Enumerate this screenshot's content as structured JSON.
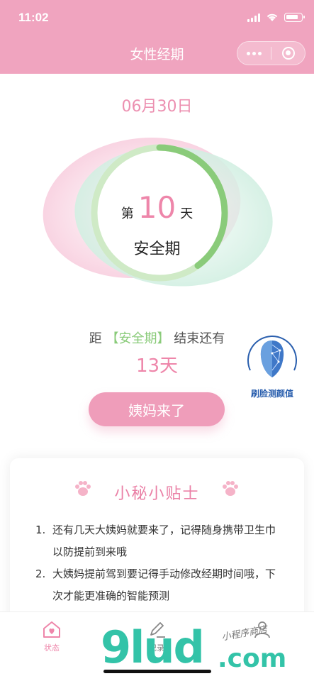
{
  "status": {
    "time": "11:02"
  },
  "nav": {
    "title": "女性经期"
  },
  "date": "06月30日",
  "ring": {
    "prefix": "第",
    "day": "10",
    "suffix": "天",
    "phase": "安全期",
    "progress": 0.4
  },
  "countdown": {
    "pre": "距",
    "phase_tag": "【安全期】",
    "post": "结束还有",
    "days": "13天"
  },
  "face_badge": {
    "label": "刷脸测颜值"
  },
  "primary_button": {
    "label": "姨妈来了"
  },
  "tips": {
    "title": "小秘小贴士",
    "items": [
      {
        "num": "1.",
        "text": "还有几天大姨妈就要来了，记得随身携带卫生巾以防提前到来哦"
      },
      {
        "num": "2.",
        "text": "大姨妈提前驾到要记得手动修改经期时间哦，下次才能更准确的智能预测"
      }
    ]
  },
  "tabbar": {
    "items": [
      {
        "label": "状态"
      },
      {
        "label": "记录"
      },
      {
        "label": ""
      }
    ]
  },
  "watermark": {
    "brand": "9lud",
    "tld": ".com",
    "script": "小程序商店"
  },
  "colors": {
    "brand_pink": "#f0a4bf",
    "accent_pink": "#ee86aa",
    "ring_green": "#8acb7a",
    "face_blue": "#2a5fae"
  }
}
